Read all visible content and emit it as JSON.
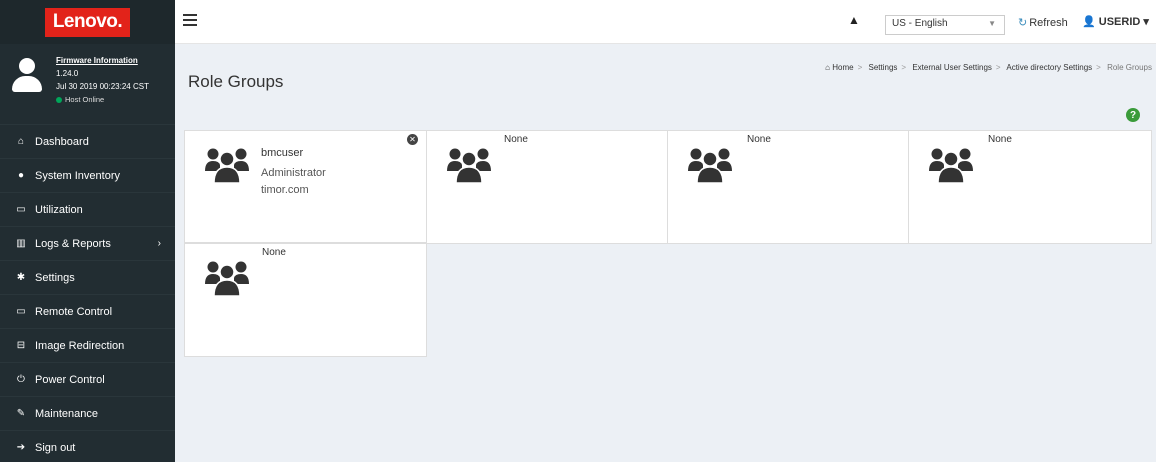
{
  "sidebar": {
    "logo": "Lenovo.",
    "firmware": {
      "link": "Firmware Information",
      "version": "1.24.0",
      "date": "Jul 30 2019 00:23:24 CST",
      "status": "Host Online"
    },
    "items": [
      {
        "label": "Dashboard",
        "icon": "home-icon",
        "glyph": "⌂"
      },
      {
        "label": "System Inventory",
        "icon": "info-icon",
        "glyph": "●"
      },
      {
        "label": "Utilization",
        "icon": "laptop-icon",
        "glyph": "▭"
      },
      {
        "label": "Logs & Reports",
        "icon": "bar-chart-icon",
        "glyph": "▥"
      },
      {
        "label": "Settings",
        "icon": "gear-icon",
        "glyph": "✱"
      },
      {
        "label": "Remote Control",
        "icon": "monitor-icon",
        "glyph": "▭"
      },
      {
        "label": "Image Redirection",
        "icon": "drive-icon",
        "glyph": "⊟"
      },
      {
        "label": "Power Control",
        "icon": "power-icon",
        "glyph": "⏻"
      },
      {
        "label": "Maintenance",
        "icon": "wrench-icon",
        "glyph": "✎"
      },
      {
        "label": "Sign out",
        "icon": "sign-out-icon",
        "glyph": "➔"
      }
    ]
  },
  "header": {
    "language": "US - English",
    "refresh": "Refresh",
    "user": "USERID"
  },
  "page": {
    "title": "Role Groups",
    "breadcrumb": [
      "Home",
      "Settings",
      "External User Settings",
      "Active directory Settings",
      "Role Groups"
    ]
  },
  "groups": [
    {
      "name": "bmcuser",
      "role": "Administrator",
      "domain": "timor.com"
    },
    {
      "name": "None"
    },
    {
      "name": "None"
    },
    {
      "name": "None"
    },
    {
      "name": "None"
    }
  ],
  "colors": {
    "sidebar_bg": "#222d32",
    "logo_red": "#e2231a",
    "status_green": "#00a65a",
    "help_green": "#3a9b3a"
  }
}
